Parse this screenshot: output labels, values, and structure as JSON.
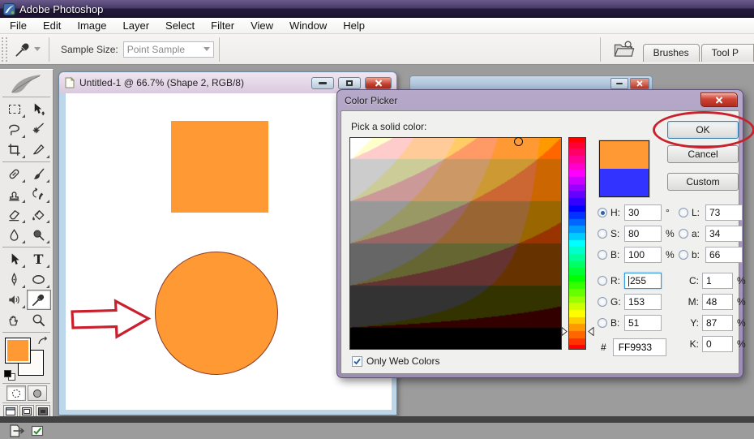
{
  "window": {
    "title": "Adobe Photoshop"
  },
  "menubar": {
    "items": [
      "File",
      "Edit",
      "Image",
      "Layer",
      "Select",
      "Filter",
      "View",
      "Window",
      "Help"
    ]
  },
  "options_bar": {
    "tool_icon": "eyedropper-icon",
    "sample_size_label": "Sample Size:",
    "sample_size_value": "Point Sample",
    "palette_tabs": [
      "Brushes",
      "Tool P"
    ]
  },
  "toolbox": {
    "tools": [
      "rectangular-marquee",
      "move",
      "lasso",
      "magic-wand",
      "crop",
      "slice",
      "healing-brush",
      "brush",
      "clone-stamp",
      "history-brush",
      "eraser",
      "paint-bucket",
      "blur",
      "dodge",
      "path-selection",
      "type",
      "pen",
      "ellipse-shape",
      "audio-annotation",
      "eyedropper",
      "hand",
      "zoom"
    ],
    "selected_tool": "eyedropper",
    "foreground_color": "#FF9933",
    "background_color": "#FFFFFF"
  },
  "document_window": {
    "title": "Untitled-1 @ 66.7% (Shape 2, RGB/8)",
    "shapes": {
      "square_fill": "#FF9933",
      "circle_fill": "#FF9933",
      "circle_stroke": "#8a3a28"
    },
    "annotation_color": "#c9202e"
  },
  "color_picker": {
    "title": "Color Picker",
    "prompt": "Pick a solid color:",
    "ok_label": "OK",
    "cancel_label": "Cancel",
    "custom_label": "Custom",
    "new_color": "#FF9933",
    "current_color": "#3333FF",
    "hue": 30,
    "saturation": 80,
    "brightness": 100,
    "only_web_colors": true,
    "checkbox_label": "Only Web Colors",
    "hex_label": "#",
    "hex_value": "FF9933",
    "hsb_rgb_rows": [
      {
        "label": "H:",
        "value": "30",
        "unit": "°",
        "radio": true,
        "checked": true
      },
      {
        "label": "S:",
        "value": "80",
        "unit": "%",
        "radio": true
      },
      {
        "label": "B:",
        "value": "100",
        "unit": "%",
        "radio": true
      },
      {
        "label": "R:",
        "value": "255",
        "radio": true,
        "focused": true
      },
      {
        "label": "G:",
        "value": "153",
        "radio": true
      },
      {
        "label": "B:",
        "value": "51",
        "radio": true
      }
    ],
    "lab_rows": [
      {
        "label": "L:",
        "value": "73",
        "radio": true
      },
      {
        "label": "a:",
        "value": "34",
        "radio": true
      },
      {
        "label": "b:",
        "value": "66",
        "radio": true
      }
    ],
    "cmyk_rows": [
      {
        "label": "C:",
        "value": "1",
        "unit": "%"
      },
      {
        "label": "M:",
        "value": "48",
        "unit": "%"
      },
      {
        "label": "Y:",
        "value": "87",
        "unit": "%"
      },
      {
        "label": "K:",
        "value": "0",
        "unit": "%"
      }
    ]
  }
}
